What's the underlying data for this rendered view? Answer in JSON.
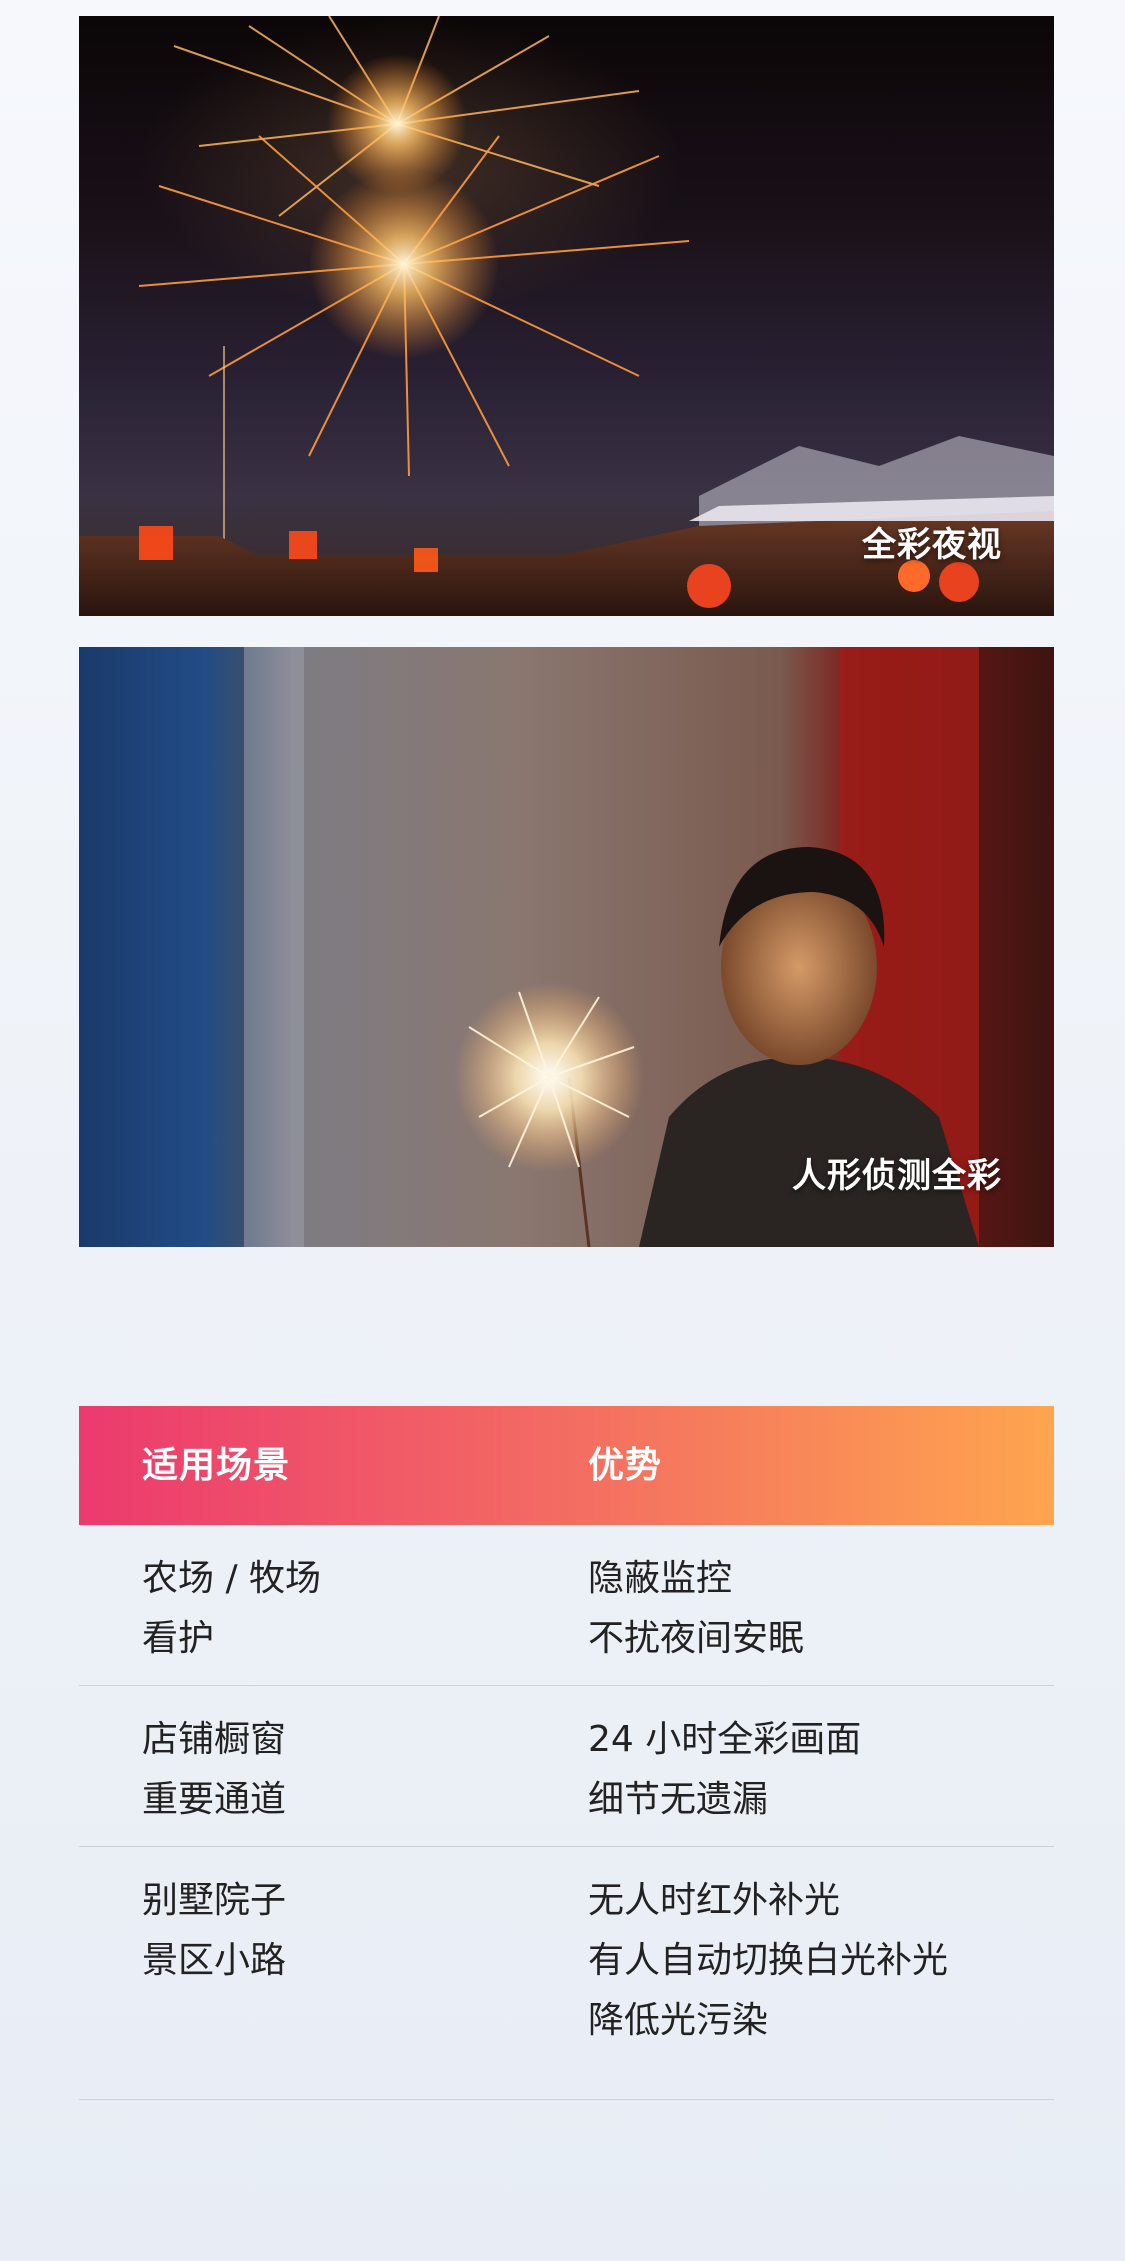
{
  "panels": [
    {
      "caption": "全彩夜视"
    },
    {
      "caption": "人形侦测全彩"
    }
  ],
  "table": {
    "headers": {
      "scenario": "适用场景",
      "advantage": "优势"
    },
    "rows": [
      {
        "scenario": [
          "农场 / 牧场",
          "看护"
        ],
        "advantage": [
          "隐蔽监控",
          "不扰夜间安眠"
        ]
      },
      {
        "scenario": [
          "店铺橱窗",
          "重要通道"
        ],
        "advantage": [
          "24 小时全彩画面",
          "细节无遗漏"
        ]
      },
      {
        "scenario": [
          "别墅院子",
          "景区小路"
        ],
        "advantage": [
          "无人时红外补光",
          "有人自动切换白光补光",
          "降低光污染"
        ]
      }
    ]
  },
  "colors": {
    "header_gradient_start": "#ec3a6e",
    "header_gradient_end": "#fea54e",
    "row_text": "#222222",
    "caption_text": "#ffffff"
  }
}
